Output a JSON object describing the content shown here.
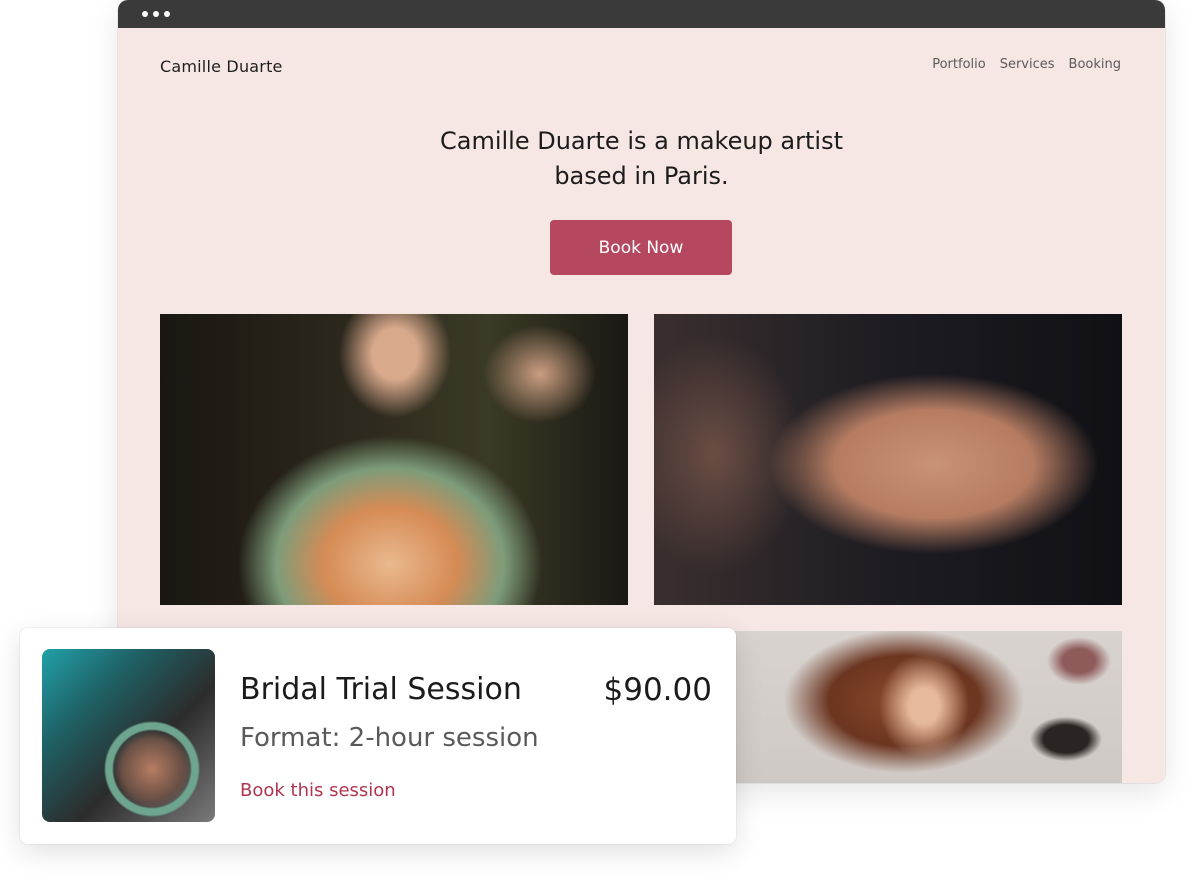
{
  "browser": {
    "window_controls": [
      "dot",
      "dot",
      "dot"
    ]
  },
  "site": {
    "brand": "Camille Duarte",
    "nav": [
      {
        "label": "Portfolio"
      },
      {
        "label": "Services"
      },
      {
        "label": "Booking"
      }
    ],
    "hero": {
      "line1": "Camille Duarte is a makeup artist",
      "line2": "based in Paris."
    },
    "cta_label": "Book Now",
    "accent_color": "#b5485e",
    "background_color": "#f6e6e4"
  },
  "card": {
    "title": "Bridal Trial Session",
    "price": "$90.00",
    "format": "Format: 2-hour session",
    "link": "Book this session",
    "link_color": "#b0344e"
  }
}
